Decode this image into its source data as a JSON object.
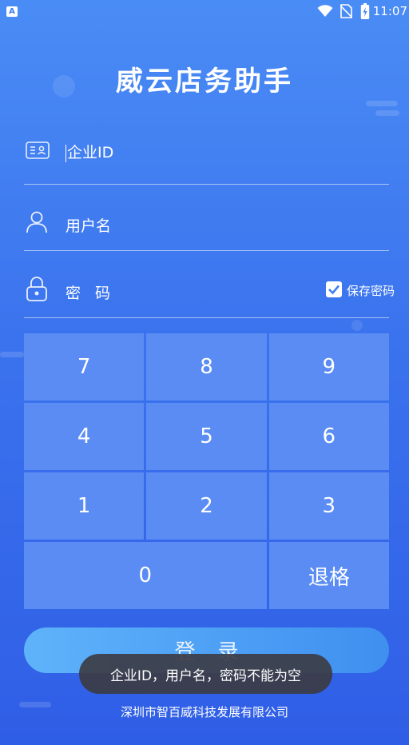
{
  "status_bar": {
    "left_badge": "A",
    "time": "11:07"
  },
  "app": {
    "title": "威云店务助手"
  },
  "form": {
    "company_id_placeholder": "企业ID",
    "username_placeholder": "用户名",
    "password_placeholder": "密码",
    "save_password_label": "保存密码",
    "save_password_checked": true
  },
  "keypad": {
    "keys": [
      "7",
      "8",
      "9",
      "4",
      "5",
      "6",
      "1",
      "2",
      "3"
    ],
    "zero": "0",
    "backspace": "退格"
  },
  "login_button": "登录",
  "toast": "企业ID，用户名，密码不能为空",
  "footer": {
    "company": "深圳市智百威科技发展有限公司"
  },
  "colors": {
    "background": "#3f7ff0",
    "key": "#5a8cf3",
    "toast": "#3c3c44",
    "button_gradient": [
      "#5fb3fa",
      "#3f8ff0"
    ]
  },
  "icons": [
    "id-card-icon",
    "user-icon",
    "lock-icon",
    "checkbox-checked-icon",
    "wifi-icon",
    "no-sim-icon",
    "battery-icon"
  ]
}
